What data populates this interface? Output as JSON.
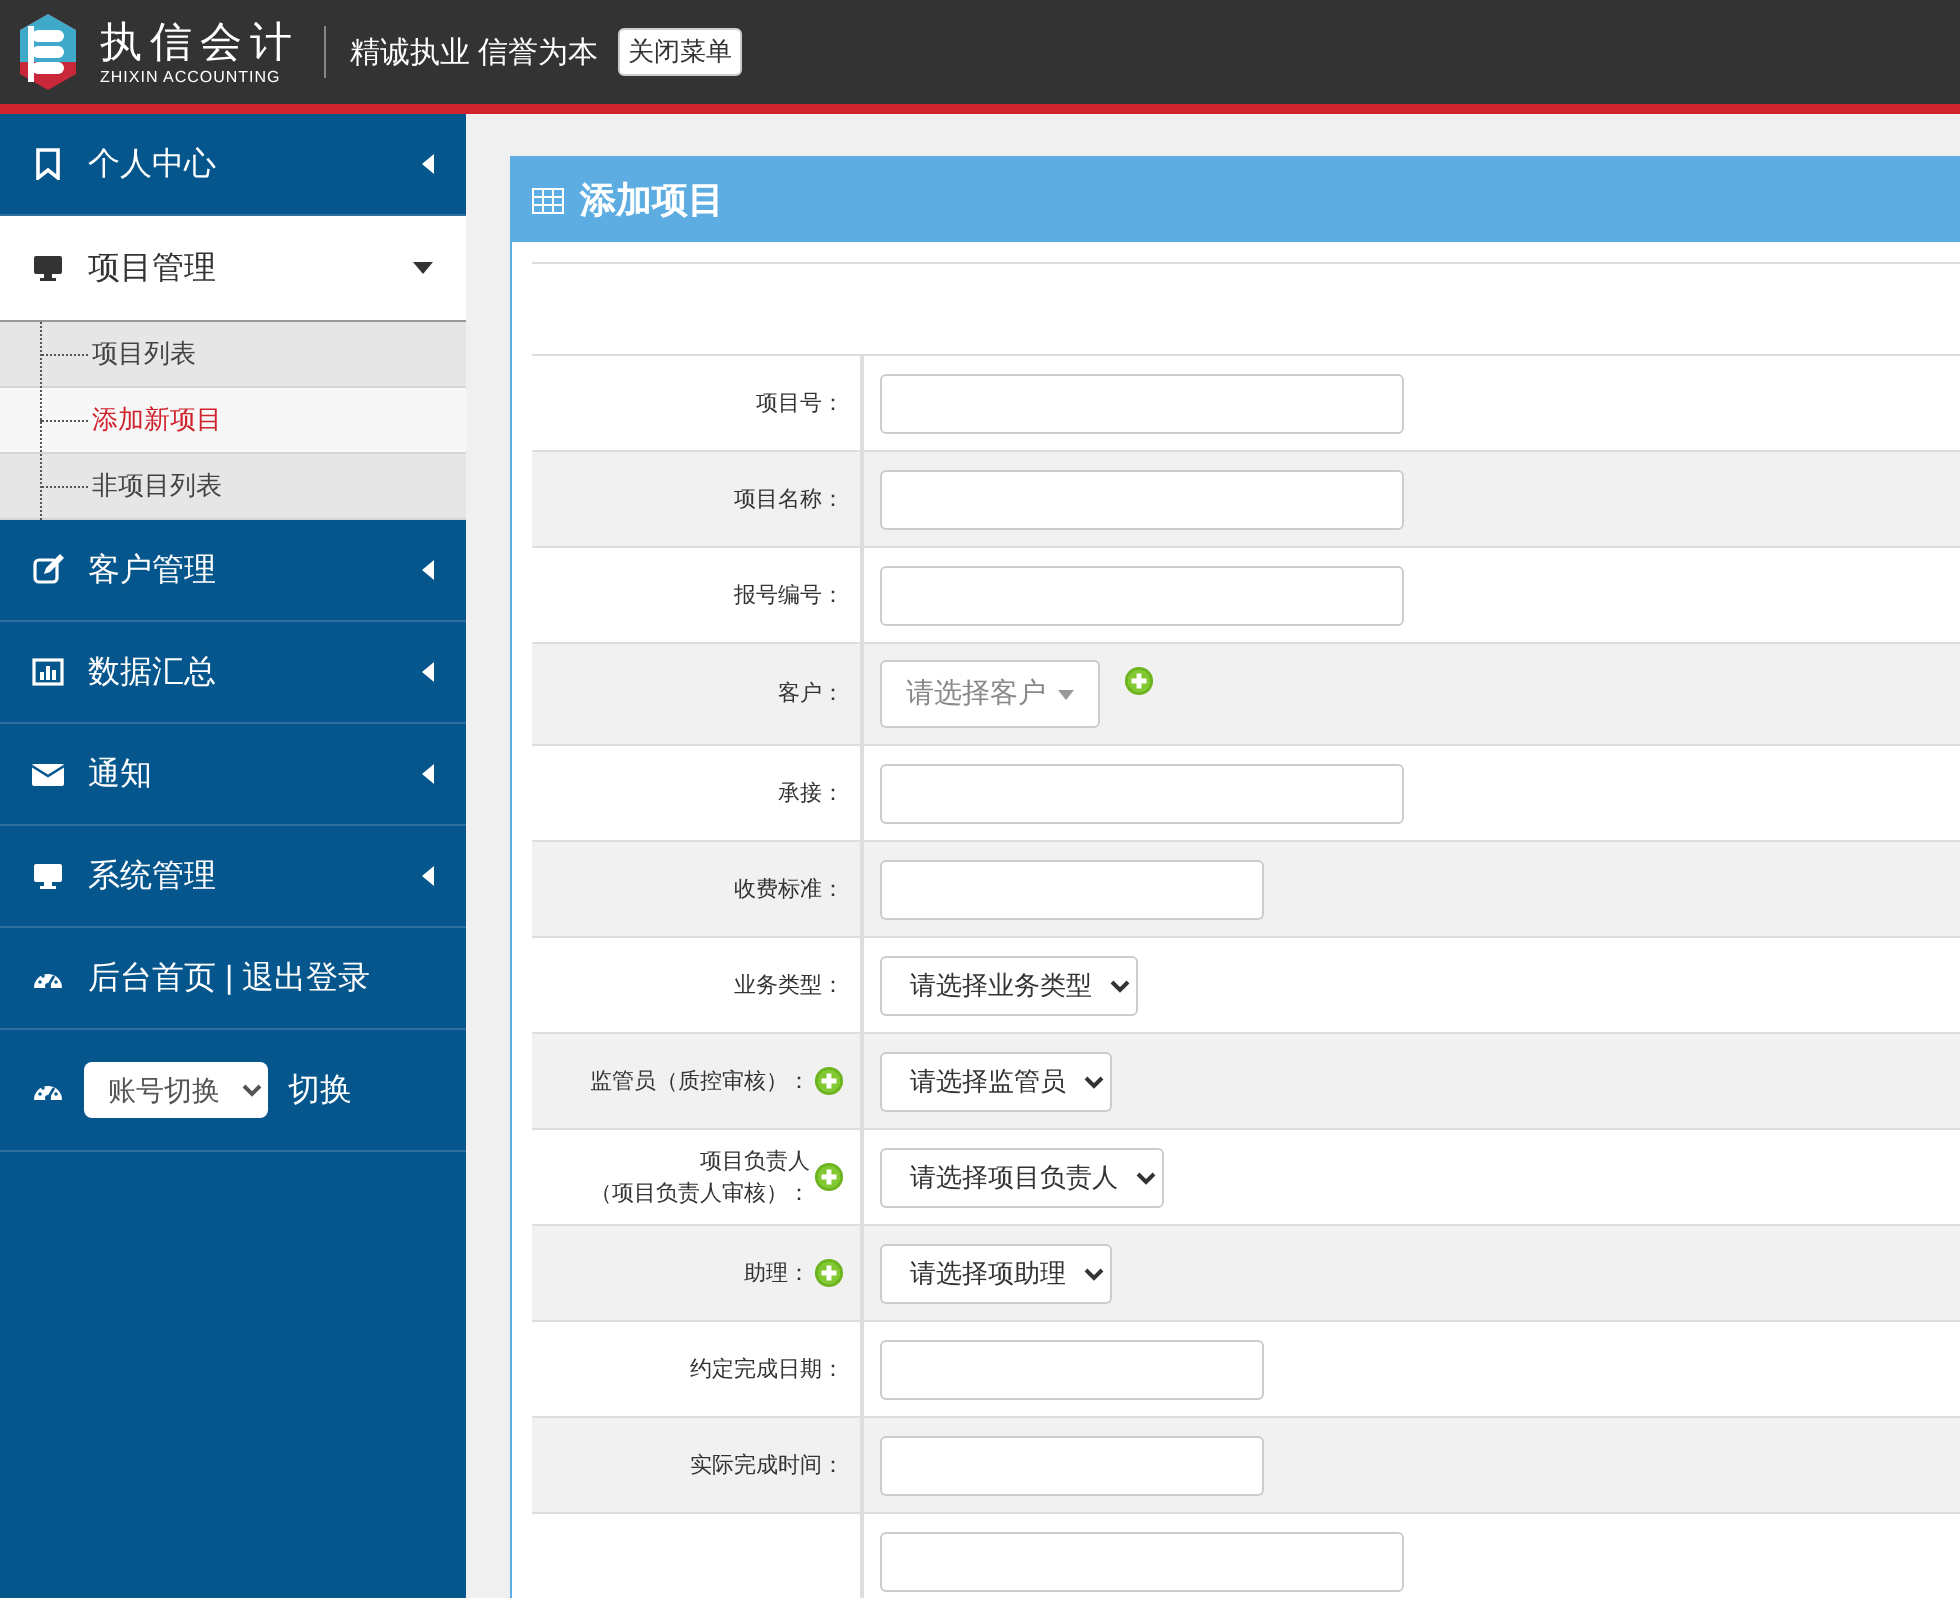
{
  "header": {
    "brand": "执信会计",
    "brand_sub": "ZHIXIN ACCOUNTING",
    "slogan": "精诚执业 信誉为本",
    "toggle_button": "关闭菜单"
  },
  "sidebar": {
    "items": [
      {
        "kind": "menu",
        "label": "个人中心",
        "expanded": false
      },
      {
        "kind": "menu",
        "label": "项目管理",
        "expanded": true,
        "children": [
          {
            "label": "项目列表",
            "selected": false
          },
          {
            "label": "添加新项目",
            "selected": true
          },
          {
            "label": "非项目列表",
            "selected": false
          }
        ]
      },
      {
        "kind": "menu",
        "label": "客户管理",
        "expanded": false
      },
      {
        "kind": "menu",
        "label": "数据汇总",
        "expanded": false
      },
      {
        "kind": "menu",
        "label": "通知",
        "expanded": false
      },
      {
        "kind": "menu",
        "label": "系统管理",
        "expanded": false
      },
      {
        "kind": "link",
        "label": "后台首页 | 退出登录"
      },
      {
        "kind": "switch",
        "select": "账号切换",
        "label": "切换"
      }
    ]
  },
  "panel": {
    "title": "添加项目",
    "rows": [
      {
        "label": "项目号：",
        "kind": "text",
        "add_button": false
      },
      {
        "label": "项目名称：",
        "kind": "text",
        "add_button": false
      },
      {
        "label": "报号编号：",
        "kind": "text",
        "add_button": false
      },
      {
        "label": "客户：",
        "kind": "combo",
        "placeholder": "请选择客户",
        "add_button": true
      },
      {
        "label": "承接：",
        "kind": "text",
        "add_button": false
      },
      {
        "label": "收费标准：",
        "kind": "short-text",
        "add_button": false
      },
      {
        "label": "业务类型：",
        "kind": "select",
        "value": "请选择业务类型",
        "add_button": false
      },
      {
        "label": "监管员（质控审核）：",
        "kind": "select",
        "value": "请选择监管员",
        "add_button": true
      },
      {
        "label": "项目负责人",
        "sublabel": "（项目负责人审核）：",
        "kind": "select",
        "value": "请选择项目负责人",
        "add_button": true
      },
      {
        "label": "助理：",
        "kind": "select",
        "value": "请选择项助理",
        "add_button": true
      },
      {
        "label": "约定完成日期：",
        "kind": "short-text",
        "add_button": false
      },
      {
        "label": "实际完成时间：",
        "kind": "short-text",
        "add_button": false
      },
      {
        "kind": "text",
        "add_button": false
      }
    ]
  }
}
